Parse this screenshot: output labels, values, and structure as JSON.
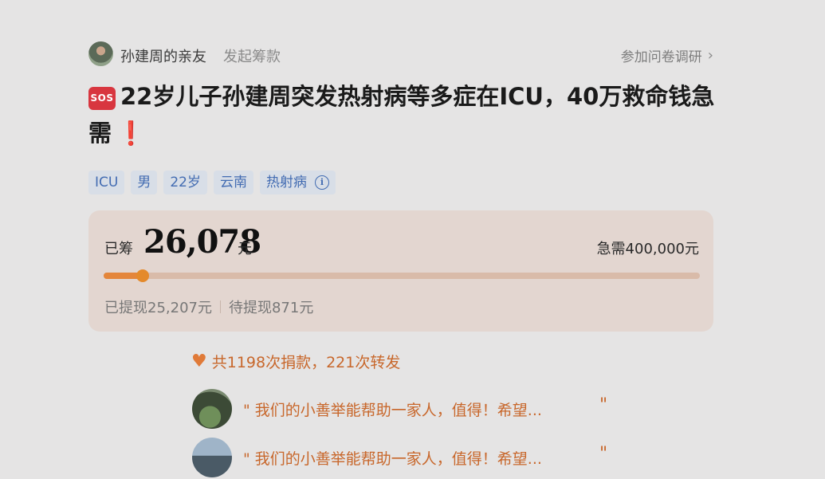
{
  "header": {
    "organizer": "孙建周的亲友",
    "organizer_suffix": "发起筹款",
    "survey_link": "参加问卷调研",
    "chevron": "›"
  },
  "title": {
    "badge": "SOS",
    "text": "22岁儿子孙建周突发热射病等多症在ICU，40万救命钱急需",
    "exclaim": "❗"
  },
  "tags": [
    "ICU",
    "男",
    "22岁",
    "云南",
    "热射病"
  ],
  "info_icon": "i",
  "progress": {
    "raised_label": "已筹",
    "raised_amount": "26,078",
    "raised_unit": "元",
    "target_text": "急需400,000元",
    "progress_fraction": 0.065,
    "withdrawn": "已提现25,207元",
    "pending": "待提现871元",
    "accent_color": "#e4863b"
  },
  "donations": {
    "summary": "共1198次捐款，221次转发",
    "comments": [
      {
        "text": "\" 我们的小善举能帮助一家人，值得！希望...",
        "close_quote": "\""
      },
      {
        "text": "\" 我们的小善举能帮助一家人，值得！希望...",
        "close_quote": "\""
      }
    ]
  }
}
